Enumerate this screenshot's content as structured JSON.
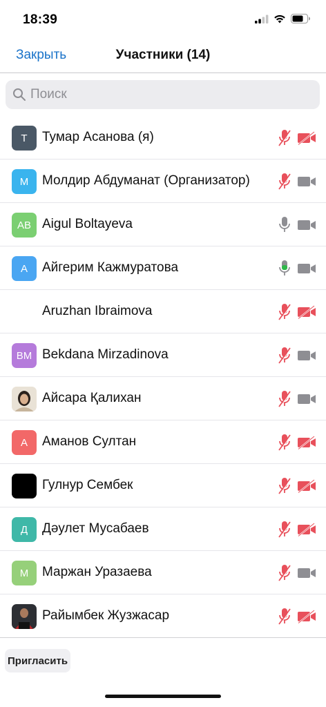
{
  "status": {
    "time": "18:39"
  },
  "nav": {
    "close_label": "Закрыть",
    "title": "Участники (14)"
  },
  "search": {
    "placeholder": "Поиск",
    "value": ""
  },
  "colors": {
    "accent": "#1a73c9",
    "muted_red": "#e8505b",
    "active_green": "#2fb84a",
    "icon_gray": "#8e8e93"
  },
  "participants": [
    {
      "name": "Тумар Асанова (я)",
      "initials": "Т",
      "avatar_color": "#4a5866",
      "mic": "muted",
      "video": "off"
    },
    {
      "name": "Молдир Абдуманат (Организатор)",
      "initials": "М",
      "avatar_color": "#3ab4ee",
      "mic": "muted",
      "video": "on"
    },
    {
      "name": "Aigul Boltayeva",
      "initials": "AB",
      "avatar_color": "#7bcf72",
      "mic": "on",
      "video": "on"
    },
    {
      "name": "Айгерим Кажмуратова",
      "initials": "А",
      "avatar_color": "#4aa6f2",
      "mic": "speaking",
      "video": "on"
    },
    {
      "name": "Aruzhan Ibraimova",
      "initials": "",
      "avatar_color": "#ffffff",
      "mic": "muted",
      "video": "off"
    },
    {
      "name": "Bekdana Mirzadinova",
      "initials": "BM",
      "avatar_color": "#b57bdb",
      "mic": "muted",
      "video": "on"
    },
    {
      "name": "Айсара Қалихан",
      "initials": "",
      "avatar_color": "photo-light",
      "mic": "muted",
      "video": "on"
    },
    {
      "name": "Аманов Султан",
      "initials": "А",
      "avatar_color": "#f26868",
      "mic": "muted",
      "video": "off"
    },
    {
      "name": "Гулнур Сембек",
      "initials": "",
      "avatar_color": "#000000",
      "mic": "muted",
      "video": "off"
    },
    {
      "name": "Дәулет Мусабаев",
      "initials": "Д",
      "avatar_color": "#3fb8a8",
      "mic": "muted",
      "video": "off"
    },
    {
      "name": "Маржан Уразаева",
      "initials": "М",
      "avatar_color": "#96d07a",
      "mic": "muted",
      "video": "on"
    },
    {
      "name": "Райымбек Жузжасар",
      "initials": "",
      "avatar_color": "photo-dark",
      "mic": "muted",
      "video": "off"
    }
  ],
  "footer": {
    "invite_label": "Пригласить"
  }
}
